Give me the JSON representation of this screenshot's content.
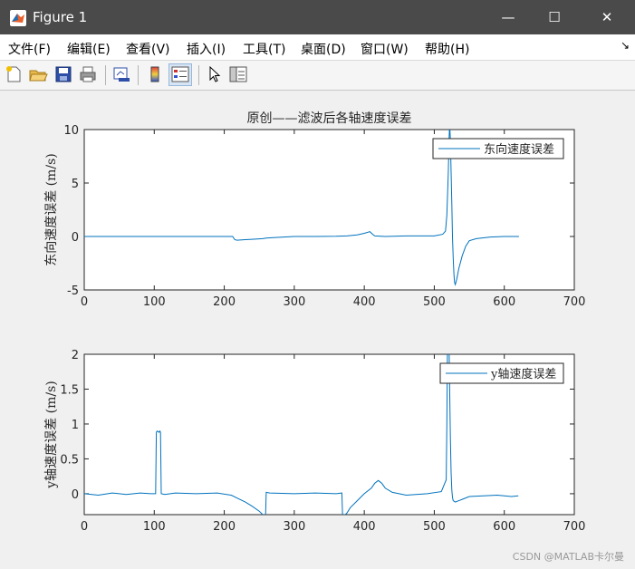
{
  "window": {
    "title": "Figure 1",
    "minimize_symbol": "—",
    "maximize_symbol": "☐",
    "close_symbol": "✕",
    "accent": "#4a4a4a"
  },
  "menu": {
    "items": [
      "文件(F)",
      "编辑(E)",
      "查看(V)",
      "插入(I)",
      "工具(T)",
      "桌面(D)",
      "窗口(W)",
      "帮助(H)"
    ],
    "corner_symbol": "↘"
  },
  "toolbar": {
    "icons": [
      "new-figure-icon",
      "open-folder-icon",
      "save-icon",
      "print-icon",
      "link-figure-icon",
      "colorbar-icon",
      "legend-icon",
      "pointer-icon",
      "property-inspector-icon"
    ]
  },
  "watermark": "CSDN @MATLAB卡尔曼",
  "chart_data": [
    {
      "type": "line",
      "title": "原创——滤波后各轴速度误差",
      "ylabel": "东向速度误差 (m/s)",
      "xlabel": "",
      "xlim": [
        0,
        700
      ],
      "ylim": [
        -5,
        10
      ],
      "xticks": [
        0,
        100,
        200,
        300,
        400,
        500,
        600,
        700
      ],
      "yticks": [
        -5,
        0,
        5,
        10
      ],
      "legend_position": "top-right",
      "color": "#0072bd",
      "series": [
        {
          "name": "东向速度误差",
          "x": [
            0,
            50,
            100,
            150,
            200,
            212,
            215,
            218,
            230,
            245,
            255,
            260,
            270,
            285,
            300,
            330,
            360,
            375,
            390,
            400,
            408,
            412,
            415,
            430,
            460,
            500,
            512,
            516,
            518,
            520,
            521,
            522,
            523,
            524,
            525,
            526,
            527,
            528,
            529,
            530,
            532,
            535,
            540,
            545,
            550,
            560,
            580,
            600,
            621
          ],
          "y": [
            0,
            0,
            0,
            0,
            0,
            0,
            -0.3,
            -0.35,
            -0.3,
            -0.25,
            -0.2,
            -0.15,
            -0.1,
            -0.05,
            0,
            0,
            0.02,
            0.05,
            0.15,
            0.3,
            0.45,
            0.2,
            0.05,
            0,
            0.05,
            0.05,
            0.2,
            0.5,
            2,
            6,
            9,
            10.5,
            9,
            6,
            3,
            0,
            -2,
            -3.5,
            -4.3,
            -4.5,
            -4,
            -3,
            -1.8,
            -0.9,
            -0.4,
            -0.2,
            -0.05,
            0,
            0
          ]
        }
      ]
    },
    {
      "type": "line",
      "title": "",
      "ylabel": "y轴速度误差 (m/s)",
      "xlabel": "",
      "xlim": [
        0,
        700
      ],
      "ylim": [
        -0.3,
        2
      ],
      "xticks": [
        0,
        100,
        200,
        300,
        400,
        500,
        600,
        700
      ],
      "yticks": [
        0,
        0.5,
        1,
        1.5,
        2
      ],
      "legend_position": "top-right",
      "color": "#0072bd",
      "series": [
        {
          "name": "y轴速度误差",
          "x": [
            0,
            20,
            40,
            60,
            80,
            95,
            102,
            103,
            104,
            107,
            108,
            109,
            110,
            115,
            130,
            160,
            190,
            210,
            220,
            230,
            240,
            250,
            255,
            258,
            259,
            260,
            265,
            300,
            330,
            360,
            368,
            369,
            370,
            375,
            380,
            390,
            400,
            410,
            415,
            420,
            425,
            430,
            440,
            460,
            490,
            510,
            517,
            518,
            519,
            520,
            521,
            522,
            523,
            524,
            525,
            526,
            527,
            530,
            540,
            550,
            570,
            590,
            610,
            620
          ],
          "y": [
            0,
            -0.02,
            0.01,
            -0.01,
            0.01,
            0,
            0,
            0.88,
            0.9,
            0.88,
            0.9,
            0.88,
            0,
            -0.01,
            0.01,
            0,
            0.01,
            -0.02,
            -0.07,
            -0.12,
            -0.18,
            -0.25,
            -0.3,
            -0.32,
            -0.3,
            0.02,
            0.01,
            0,
            0.01,
            0,
            0.01,
            -0.32,
            -0.32,
            -0.28,
            -0.2,
            -0.1,
            0,
            0.08,
            0.15,
            0.19,
            0.15,
            0.08,
            0.02,
            -0.02,
            0,
            0.03,
            0.2,
            1,
            2.3,
            2.4,
            2.2,
            1.5,
            0.8,
            0.3,
            0.05,
            -0.05,
            -0.1,
            -0.12,
            -0.08,
            -0.04,
            -0.03,
            -0.02,
            -0.04,
            -0.03
          ]
        }
      ]
    }
  ]
}
